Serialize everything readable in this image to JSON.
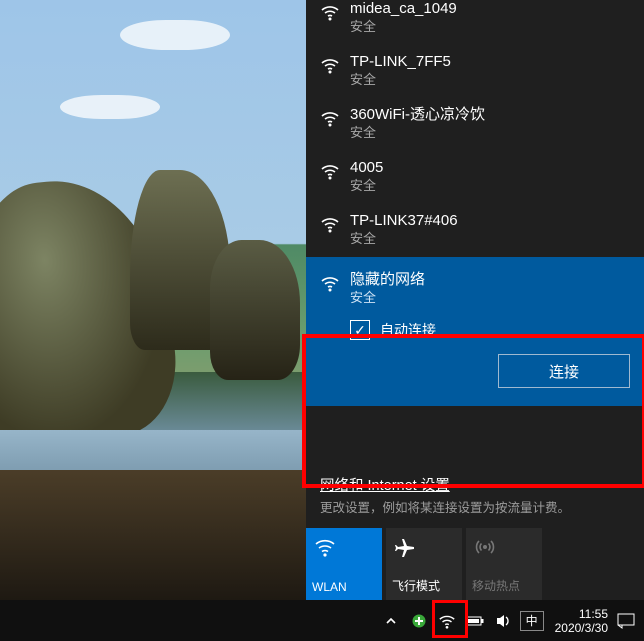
{
  "networks": [
    {
      "ssid": "midea_ca_1049",
      "security": "安全"
    },
    {
      "ssid": "TP-LINK_7FF5",
      "security": "安全"
    },
    {
      "ssid": "360WiFi-透心凉冷饮",
      "security": "安全"
    },
    {
      "ssid": "4005",
      "security": "安全"
    },
    {
      "ssid": "TP-LINK37#406",
      "security": "安全"
    }
  ],
  "selected": {
    "ssid": "隐藏的网络",
    "security": "安全",
    "auto_label": "自动连接",
    "auto_checked": true,
    "connect_label": "连接"
  },
  "settings": {
    "title": "网络和 Internet 设置",
    "desc": "更改设置，例如将某连接设置为按流量计费。"
  },
  "quick": {
    "wlan": "WLAN",
    "airplane": "飞行模式",
    "hotspot": "移动热点"
  },
  "tray": {
    "ime": "中",
    "time": "11:55",
    "date": "2020/3/30"
  }
}
